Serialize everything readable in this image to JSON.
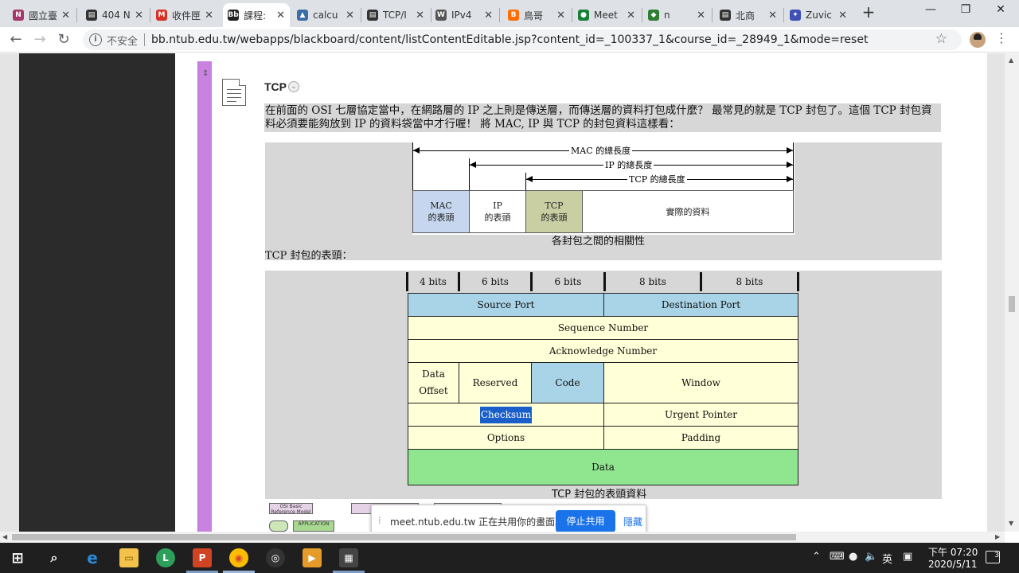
{
  "tabs": [
    {
      "label": "國立臺",
      "favicon": "N",
      "color": "#a33a6b"
    },
    {
      "label": "404 N",
      "favicon": "▤",
      "color": "#333333"
    },
    {
      "label": "收件匣",
      "favicon": "M",
      "color": "#d93025"
    },
    {
      "label": "課程:",
      "favicon": "Bb",
      "color": "#222222"
    },
    {
      "label": "calcu",
      "favicon": "▲",
      "color": "#3b6ea5"
    },
    {
      "label": "TCP/I",
      "favicon": "▤",
      "color": "#333333"
    },
    {
      "label": "IPv4",
      "favicon": "W",
      "color": "#555555"
    },
    {
      "label": "鳥哥",
      "favicon": "B",
      "color": "#ff6d00"
    },
    {
      "label": "Meet",
      "favicon": "●",
      "color": "#188038"
    },
    {
      "label": "n",
      "favicon": "◆",
      "color": "#2e7d32"
    },
    {
      "label": "北商",
      "favicon": "▤",
      "color": "#333333"
    },
    {
      "label": "Zuvic",
      "favicon": "✦",
      "color": "#3f51b5"
    }
  ],
  "address": {
    "security": "不安全",
    "url": "bb.ntub.edu.tw/webapps/blackboard/content/listContentEditable.jsp?content_id=_100337_1&course_id=_28949_1&mode=reset"
  },
  "item": {
    "title": "TCP",
    "intro": "在前面的 OSI 七層協定當中，在網路層的 IP 之上則是傳送層，而傳送層的資料打包成什麼？ 最常見的就是 TCP 封包了。這個 TCP 封包資料必須要能夠放到 IP 的資料袋當中才行喔！ 將 MAC, IP 與 TCP 的封包資料這樣看："
  },
  "figure1": {
    "mac_len": "MAC 的總長度",
    "ip_len": "IP 的總長度",
    "tcp_len": "TCP 的總長度",
    "mac_hdr": [
      "MAC",
      "的表頭"
    ],
    "ip_hdr": [
      "IP",
      "的表頭"
    ],
    "tcp_hdr": [
      "TCP",
      "的表頭"
    ],
    "payload": "實際的資料",
    "caption": "各封包之間的相關性",
    "colors": {
      "mac": "#c6d6ee",
      "ip": "#ffffff",
      "tcp": "#c9cfa3"
    }
  },
  "header_caption": "TCP 封包的表頭：",
  "figure2": {
    "bits": [
      "4 bits",
      "6 bits",
      "6 bits",
      "8 bits",
      "8 bits"
    ],
    "source_port": "Source Port",
    "destination_port": "Destination Port",
    "sequence_number": "Sequence Number",
    "acknowledge_number": "Acknowledge Number",
    "data_offset": [
      "Data",
      "Offset"
    ],
    "reserved": "Reserved",
    "code": "Code",
    "window": "Window",
    "checksum": "Checksum",
    "urgent_pointer": "Urgent Pointer",
    "options": "Options",
    "padding": "Padding",
    "data": "Data",
    "caption": "TCP 封包的表頭資料",
    "colors": {
      "blue": "#a9d3e6",
      "cream": "#ffffd8",
      "green": "#90e58f"
    }
  },
  "thumbs": {
    "a": "OSI Basic Reference Model",
    "b": "APPLICATION"
  },
  "share": {
    "message": "meet.ntub.edu.tw 正在共用你的畫面。",
    "stop": "停止共用",
    "hide": "隱藏"
  },
  "taskbar": {
    "ime": "英",
    "time": "下午 07:20",
    "date": "2020/5/11",
    "notifications": "3"
  }
}
